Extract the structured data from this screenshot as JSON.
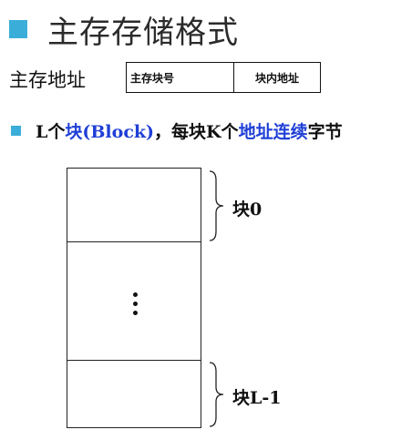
{
  "title": "主存存储格式",
  "address": {
    "label": "主存地址",
    "fields": [
      "主存块号",
      "块内地址"
    ]
  },
  "bullet": {
    "prefix": "L个",
    "block": "块(Block)",
    "middle": "，每块K个",
    "continuous": "地址连续",
    "suffix": "字节"
  },
  "memory": {
    "first_block": "块0",
    "last_block": "块L-1",
    "ellipsis": "vertical-dots"
  },
  "colors": {
    "accent_bullet": "#3aaed8",
    "highlight_text": "#1f3fd6"
  }
}
